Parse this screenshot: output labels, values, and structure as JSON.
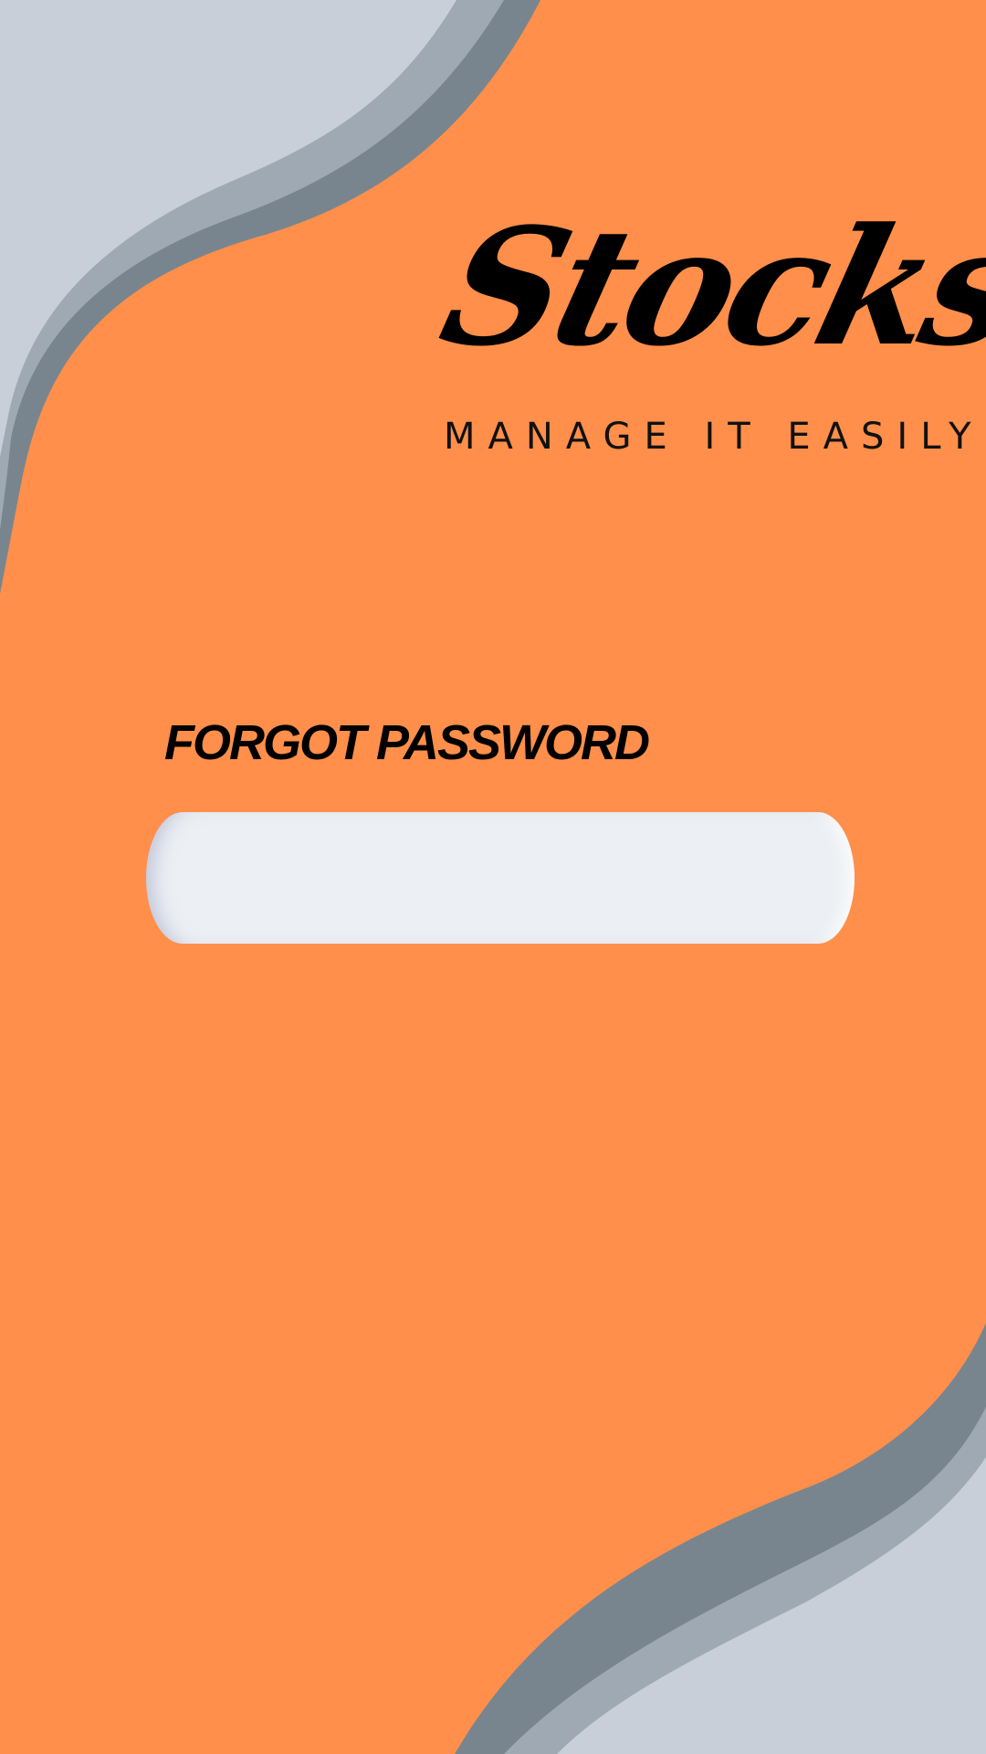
{
  "colors": {
    "background": "#FF8F4A",
    "wave_light": "#C8CFD8",
    "wave_mid": "#9EA9B4",
    "wave_dark": "#78858F",
    "input_fill": "#ECEFF3",
    "text": "#000000"
  },
  "branding": {
    "logo_text": "Stocks",
    "tagline": "MANAGE IT EASILY"
  },
  "form": {
    "heading": "FORGOT PASSWORD",
    "email_input": {
      "value": "",
      "placeholder": ""
    }
  }
}
